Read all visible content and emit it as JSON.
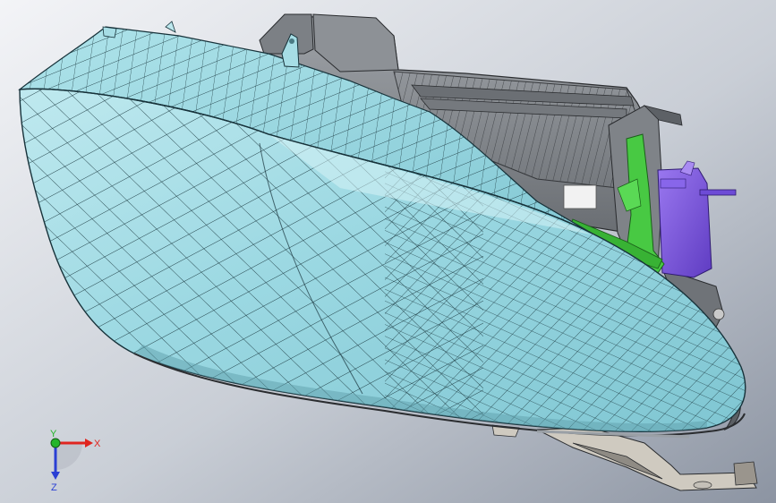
{
  "viewport": {
    "background_top": "#eef0f4",
    "background_bottom": "#8e96a4"
  },
  "model": {
    "lens_color": "#9fdbe4",
    "lens_highlight": "#c9eef2",
    "lens_shadow": "#6fb8c5",
    "housing_color": "#8a8d91",
    "housing_dark": "#5c6065",
    "bracket_color": "#c8c4bc",
    "clip_color": "#3cc23a",
    "connector_color": "#7a52d8"
  },
  "triad": {
    "x_label": "X",
    "y_label": "Y",
    "z_label": "Z",
    "x_color": "#e0251f",
    "y_color": "#25b52a",
    "z_color": "#2a3fd4"
  }
}
